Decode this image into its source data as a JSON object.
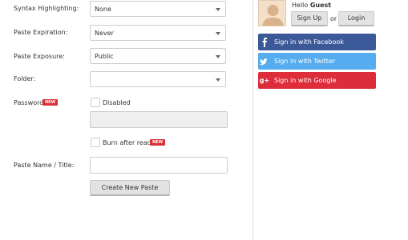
{
  "form": {
    "syntax_label": "Syntax Highlighting:",
    "syntax_value": "None",
    "expiration_label": "Paste Expiration:",
    "expiration_value": "Never",
    "exposure_label": "Paste Exposure:",
    "exposure_value": "Public",
    "folder_label": "Folder:",
    "folder_value": "",
    "password_label": "Password",
    "new_badge": "NEW",
    "disabled_label": "Disabled",
    "burn_label": "Burn after read",
    "name_label": "Paste Name / Title:",
    "name_value": "",
    "create_button": "Create New Paste"
  },
  "sidebar": {
    "hello": "Hello",
    "guest": "Guest",
    "signup": "Sign Up",
    "or": "or",
    "login": "Login",
    "facebook": "Sign in with Facebook",
    "twitter": "Sign in with Twitter",
    "google": "Sign in with Google"
  },
  "colors": {
    "facebook": "#3b5998",
    "twitter": "#55acee",
    "google": "#dd2c3a",
    "badge": "#d83036"
  },
  "icons": {
    "facebook": "facebook-icon",
    "twitter": "twitter-icon",
    "google": "google-plus-icon"
  }
}
